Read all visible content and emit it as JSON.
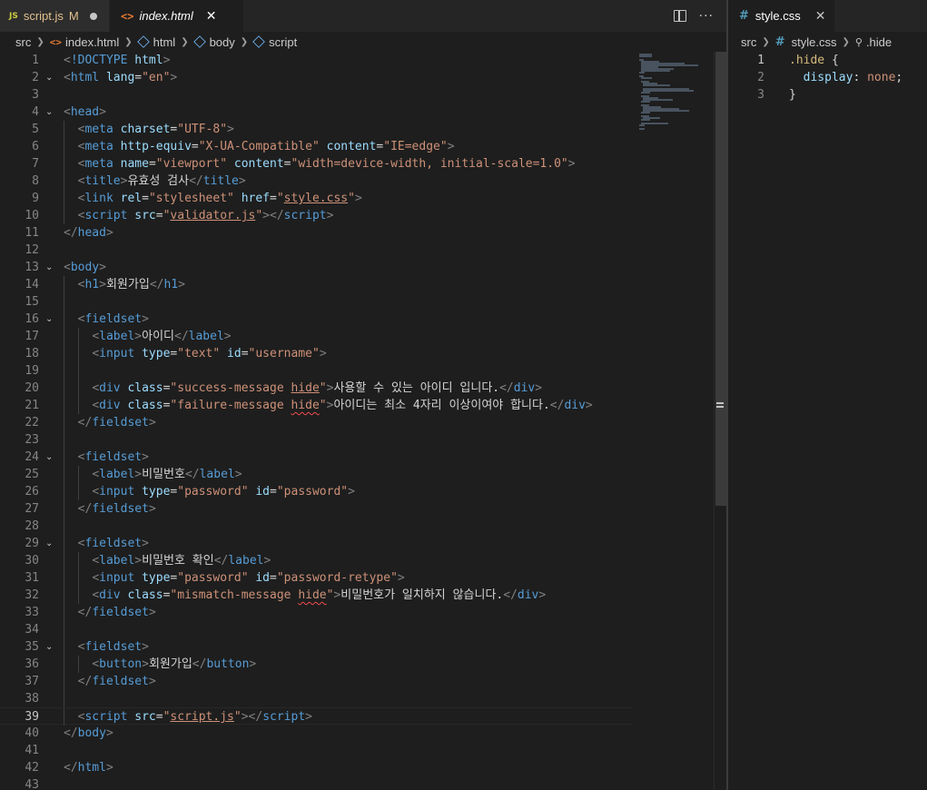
{
  "tabs": {
    "script": {
      "icon": "JS",
      "name": "script.js",
      "status": "M"
    },
    "index": {
      "icon": "<>",
      "name": "index.html",
      "close": "✕"
    },
    "actions": {
      "split": "split-editor",
      "more": "···"
    }
  },
  "breadcrumb": {
    "folder": "src",
    "file": "index.html",
    "node1": "html",
    "node2": "body",
    "node3": "script"
  },
  "right_panel": {
    "tab": {
      "icon": "#",
      "name": "style.css",
      "close": "✕"
    },
    "breadcrumb": {
      "folder": "src",
      "file": "style.css",
      "symbol": ".hide"
    },
    "lines": [
      {
        "n": "1",
        "parts": [
          [
            "c-sel",
            ".hide"
          ],
          [
            "t-txt",
            " {"
          ]
        ]
      },
      {
        "n": "2",
        "parts": [
          [
            "t-txt",
            "  "
          ],
          [
            "c-prop",
            "display"
          ],
          [
            "t-txt",
            ": "
          ],
          [
            "c-val",
            "none"
          ],
          [
            "t-txt",
            ";"
          ]
        ]
      },
      {
        "n": "3",
        "parts": [
          [
            "t-txt",
            "}"
          ]
        ]
      }
    ]
  },
  "code_lines": [
    {
      "n": "1",
      "parts": [
        [
          "t-br",
          "<"
        ],
        [
          "t-tag",
          "!DOCTYPE"
        ],
        [
          "t-txt",
          " "
        ],
        [
          "t-attr",
          "html"
        ],
        [
          "t-br",
          ">"
        ]
      ]
    },
    {
      "n": "2",
      "fold": true,
      "parts": [
        [
          "t-br",
          "<"
        ],
        [
          "t-tag",
          "html"
        ],
        [
          "t-txt",
          " "
        ],
        [
          "t-attr",
          "lang"
        ],
        [
          "t-eq",
          "="
        ],
        [
          "t-str",
          "\"en\""
        ],
        [
          "t-br",
          ">"
        ]
      ]
    },
    {
      "n": "3",
      "parts": []
    },
    {
      "n": "4",
      "fold": true,
      "parts": [
        [
          "t-br",
          "<"
        ],
        [
          "t-tag",
          "head"
        ],
        [
          "t-br",
          ">"
        ]
      ]
    },
    {
      "n": "5",
      "indent": 1,
      "parts": [
        [
          "t-br",
          "<"
        ],
        [
          "t-tag",
          "meta"
        ],
        [
          "t-txt",
          " "
        ],
        [
          "t-attr",
          "charset"
        ],
        [
          "t-eq",
          "="
        ],
        [
          "t-str",
          "\"UTF-8\""
        ],
        [
          "t-br",
          ">"
        ]
      ]
    },
    {
      "n": "6",
      "indent": 1,
      "parts": [
        [
          "t-br",
          "<"
        ],
        [
          "t-tag",
          "meta"
        ],
        [
          "t-txt",
          " "
        ],
        [
          "t-attr",
          "http-equiv"
        ],
        [
          "t-eq",
          "="
        ],
        [
          "t-str",
          "\"X-UA-Compatible\""
        ],
        [
          "t-txt",
          " "
        ],
        [
          "t-attr",
          "content"
        ],
        [
          "t-eq",
          "="
        ],
        [
          "t-str",
          "\"IE=edge\""
        ],
        [
          "t-br",
          ">"
        ]
      ]
    },
    {
      "n": "7",
      "indent": 1,
      "parts": [
        [
          "t-br",
          "<"
        ],
        [
          "t-tag",
          "meta"
        ],
        [
          "t-txt",
          " "
        ],
        [
          "t-attr",
          "name"
        ],
        [
          "t-eq",
          "="
        ],
        [
          "t-str",
          "\"viewport\""
        ],
        [
          "t-txt",
          " "
        ],
        [
          "t-attr",
          "content"
        ],
        [
          "t-eq",
          "="
        ],
        [
          "t-str",
          "\"width=device-width, initial-scale=1.0\""
        ],
        [
          "t-br",
          ">"
        ]
      ]
    },
    {
      "n": "8",
      "indent": 1,
      "parts": [
        [
          "t-br",
          "<"
        ],
        [
          "t-tag",
          "title"
        ],
        [
          "t-br",
          ">"
        ],
        [
          "t-txt",
          "유효성 검사"
        ],
        [
          "t-br",
          "</"
        ],
        [
          "t-tag",
          "title"
        ],
        [
          "t-br",
          ">"
        ]
      ]
    },
    {
      "n": "9",
      "indent": 1,
      "parts": [
        [
          "t-br",
          "<"
        ],
        [
          "t-tag",
          "link"
        ],
        [
          "t-txt",
          " "
        ],
        [
          "t-attr",
          "rel"
        ],
        [
          "t-eq",
          "="
        ],
        [
          "t-str",
          "\"stylesheet\""
        ],
        [
          "t-txt",
          " "
        ],
        [
          "t-attr",
          "href"
        ],
        [
          "t-eq",
          "="
        ],
        [
          "t-str",
          "\""
        ],
        [
          "t-str t-link",
          "style.css"
        ],
        [
          "t-str",
          "\""
        ],
        [
          "t-br",
          ">"
        ]
      ]
    },
    {
      "n": "10",
      "indent": 1,
      "parts": [
        [
          "t-br",
          "<"
        ],
        [
          "t-tag",
          "script"
        ],
        [
          "t-txt",
          " "
        ],
        [
          "t-attr",
          "src"
        ],
        [
          "t-eq",
          "="
        ],
        [
          "t-str",
          "\""
        ],
        [
          "t-str t-link",
          "validator.js"
        ],
        [
          "t-str",
          "\""
        ],
        [
          "t-br",
          "></"
        ],
        [
          "t-tag",
          "script"
        ],
        [
          "t-br",
          ">"
        ]
      ]
    },
    {
      "n": "11",
      "parts": [
        [
          "t-br",
          "</"
        ],
        [
          "t-tag",
          "head"
        ],
        [
          "t-br",
          ">"
        ]
      ]
    },
    {
      "n": "12",
      "parts": []
    },
    {
      "n": "13",
      "fold": true,
      "parts": [
        [
          "t-br",
          "<"
        ],
        [
          "t-tag",
          "body"
        ],
        [
          "t-br",
          ">"
        ]
      ]
    },
    {
      "n": "14",
      "indent": 1,
      "parts": [
        [
          "t-br",
          "<"
        ],
        [
          "t-tag",
          "h1"
        ],
        [
          "t-br",
          ">"
        ],
        [
          "t-txt",
          "회원가입"
        ],
        [
          "t-br",
          "</"
        ],
        [
          "t-tag",
          "h1"
        ],
        [
          "t-br",
          ">"
        ]
      ]
    },
    {
      "n": "15",
      "indent": 1,
      "parts": []
    },
    {
      "n": "16",
      "fold": true,
      "indent": 1,
      "parts": [
        [
          "t-br",
          "<"
        ],
        [
          "t-tag",
          "fieldset"
        ],
        [
          "t-br",
          ">"
        ]
      ]
    },
    {
      "n": "17",
      "indent": 2,
      "parts": [
        [
          "t-br",
          "<"
        ],
        [
          "t-tag",
          "label"
        ],
        [
          "t-br",
          ">"
        ],
        [
          "t-txt",
          "아이디"
        ],
        [
          "t-br",
          "</"
        ],
        [
          "t-tag",
          "label"
        ],
        [
          "t-br",
          ">"
        ]
      ]
    },
    {
      "n": "18",
      "indent": 2,
      "parts": [
        [
          "t-br",
          "<"
        ],
        [
          "t-tag",
          "input"
        ],
        [
          "t-txt",
          " "
        ],
        [
          "t-attr",
          "type"
        ],
        [
          "t-eq",
          "="
        ],
        [
          "t-str",
          "\"text\""
        ],
        [
          "t-txt",
          " "
        ],
        [
          "t-attr",
          "id"
        ],
        [
          "t-eq",
          "="
        ],
        [
          "t-str",
          "\"username\""
        ],
        [
          "t-br",
          ">"
        ]
      ]
    },
    {
      "n": "19",
      "indent": 2,
      "parts": []
    },
    {
      "n": "20",
      "indent": 2,
      "parts": [
        [
          "t-br",
          "<"
        ],
        [
          "t-tag",
          "div"
        ],
        [
          "t-txt",
          " "
        ],
        [
          "t-attr",
          "class"
        ],
        [
          "t-eq",
          "="
        ],
        [
          "t-str",
          "\"success-message "
        ],
        [
          "t-str t-link",
          "hide"
        ],
        [
          "t-str",
          "\""
        ],
        [
          "t-br",
          ">"
        ],
        [
          "t-txt",
          "사용할 수 있는 아이디 입니다."
        ],
        [
          "t-br",
          "</"
        ],
        [
          "t-tag",
          "div"
        ],
        [
          "t-br",
          ">"
        ]
      ]
    },
    {
      "n": "21",
      "indent": 2,
      "parts": [
        [
          "t-br",
          "<"
        ],
        [
          "t-tag",
          "div"
        ],
        [
          "t-txt",
          " "
        ],
        [
          "t-attr",
          "class"
        ],
        [
          "t-eq",
          "="
        ],
        [
          "t-str",
          "\"failure-message "
        ],
        [
          "t-str squig",
          "hide"
        ],
        [
          "t-str",
          "\""
        ],
        [
          "t-br",
          ">"
        ],
        [
          "t-txt",
          "아이디는 최소 4자리 이상이여야 합니다."
        ],
        [
          "t-br",
          "</"
        ],
        [
          "t-tag",
          "div"
        ],
        [
          "t-br",
          ">"
        ]
      ]
    },
    {
      "n": "22",
      "indent": 1,
      "parts": [
        [
          "t-br",
          "</"
        ],
        [
          "t-tag",
          "fieldset"
        ],
        [
          "t-br",
          ">"
        ]
      ]
    },
    {
      "n": "23",
      "indent": 1,
      "parts": []
    },
    {
      "n": "24",
      "fold": true,
      "indent": 1,
      "parts": [
        [
          "t-br",
          "<"
        ],
        [
          "t-tag",
          "fieldset"
        ],
        [
          "t-br",
          ">"
        ]
      ]
    },
    {
      "n": "25",
      "indent": 2,
      "parts": [
        [
          "t-br",
          "<"
        ],
        [
          "t-tag",
          "label"
        ],
        [
          "t-br",
          ">"
        ],
        [
          "t-txt",
          "비밀번호"
        ],
        [
          "t-br",
          "</"
        ],
        [
          "t-tag",
          "label"
        ],
        [
          "t-br",
          ">"
        ]
      ]
    },
    {
      "n": "26",
      "indent": 2,
      "parts": [
        [
          "t-br",
          "<"
        ],
        [
          "t-tag",
          "input"
        ],
        [
          "t-txt",
          " "
        ],
        [
          "t-attr",
          "type"
        ],
        [
          "t-eq",
          "="
        ],
        [
          "t-str",
          "\"password\""
        ],
        [
          "t-txt",
          " "
        ],
        [
          "t-attr",
          "id"
        ],
        [
          "t-eq",
          "="
        ],
        [
          "t-str",
          "\"password\""
        ],
        [
          "t-br",
          ">"
        ]
      ]
    },
    {
      "n": "27",
      "indent": 1,
      "parts": [
        [
          "t-br",
          "</"
        ],
        [
          "t-tag",
          "fieldset"
        ],
        [
          "t-br",
          ">"
        ]
      ]
    },
    {
      "n": "28",
      "indent": 1,
      "parts": []
    },
    {
      "n": "29",
      "fold": true,
      "indent": 1,
      "parts": [
        [
          "t-br",
          "<"
        ],
        [
          "t-tag",
          "fieldset"
        ],
        [
          "t-br",
          ">"
        ]
      ]
    },
    {
      "n": "30",
      "indent": 2,
      "parts": [
        [
          "t-br",
          "<"
        ],
        [
          "t-tag",
          "label"
        ],
        [
          "t-br",
          ">"
        ],
        [
          "t-txt",
          "비밀번호 확인"
        ],
        [
          "t-br",
          "</"
        ],
        [
          "t-tag",
          "label"
        ],
        [
          "t-br",
          ">"
        ]
      ]
    },
    {
      "n": "31",
      "indent": 2,
      "parts": [
        [
          "t-br",
          "<"
        ],
        [
          "t-tag",
          "input"
        ],
        [
          "t-txt",
          " "
        ],
        [
          "t-attr",
          "type"
        ],
        [
          "t-eq",
          "="
        ],
        [
          "t-str",
          "\"password\""
        ],
        [
          "t-txt",
          " "
        ],
        [
          "t-attr",
          "id"
        ],
        [
          "t-eq",
          "="
        ],
        [
          "t-str",
          "\"password-retype\""
        ],
        [
          "t-br",
          ">"
        ]
      ]
    },
    {
      "n": "32",
      "indent": 2,
      "parts": [
        [
          "t-br",
          "<"
        ],
        [
          "t-tag",
          "div"
        ],
        [
          "t-txt",
          " "
        ],
        [
          "t-attr",
          "class"
        ],
        [
          "t-eq",
          "="
        ],
        [
          "t-str",
          "\"mismatch-message "
        ],
        [
          "t-str squig",
          "hide"
        ],
        [
          "t-str",
          "\""
        ],
        [
          "t-br",
          ">"
        ],
        [
          "t-txt",
          "비밀번호가 일치하지 않습니다."
        ],
        [
          "t-br",
          "</"
        ],
        [
          "t-tag",
          "div"
        ],
        [
          "t-br",
          ">"
        ]
      ]
    },
    {
      "n": "33",
      "indent": 1,
      "parts": [
        [
          "t-br",
          "</"
        ],
        [
          "t-tag",
          "fieldset"
        ],
        [
          "t-br",
          ">"
        ]
      ]
    },
    {
      "n": "34",
      "indent": 1,
      "parts": []
    },
    {
      "n": "35",
      "fold": true,
      "indent": 1,
      "parts": [
        [
          "t-br",
          "<"
        ],
        [
          "t-tag",
          "fieldset"
        ],
        [
          "t-br",
          ">"
        ]
      ]
    },
    {
      "n": "36",
      "indent": 2,
      "parts": [
        [
          "t-br",
          "<"
        ],
        [
          "t-tag",
          "button"
        ],
        [
          "t-br",
          ">"
        ],
        [
          "t-txt",
          "회원가입"
        ],
        [
          "t-br",
          "</"
        ],
        [
          "t-tag",
          "button"
        ],
        [
          "t-br",
          ">"
        ]
      ]
    },
    {
      "n": "37",
      "indent": 1,
      "parts": [
        [
          "t-br",
          "</"
        ],
        [
          "t-tag",
          "fieldset"
        ],
        [
          "t-br",
          ">"
        ]
      ]
    },
    {
      "n": "38",
      "indent": 1,
      "parts": []
    },
    {
      "n": "39",
      "active": true,
      "indent": 1,
      "parts": [
        [
          "t-br",
          "<"
        ],
        [
          "t-tag",
          "script"
        ],
        [
          "t-txt",
          " "
        ],
        [
          "t-attr",
          "src"
        ],
        [
          "t-eq",
          "="
        ],
        [
          "t-str",
          "\""
        ],
        [
          "t-str t-link",
          "script.js"
        ],
        [
          "t-str",
          "\""
        ],
        [
          "t-br",
          "></"
        ],
        [
          "t-tag",
          "script"
        ],
        [
          "t-br",
          ">"
        ]
      ]
    },
    {
      "n": "40",
      "parts": [
        [
          "t-br",
          "</"
        ],
        [
          "t-tag",
          "body"
        ],
        [
          "t-br",
          ">"
        ]
      ]
    },
    {
      "n": "41",
      "parts": []
    },
    {
      "n": "42",
      "parts": [
        [
          "t-br",
          "</"
        ],
        [
          "t-tag",
          "html"
        ],
        [
          "t-br",
          ">"
        ]
      ]
    },
    {
      "n": "43",
      "parts": []
    }
  ]
}
